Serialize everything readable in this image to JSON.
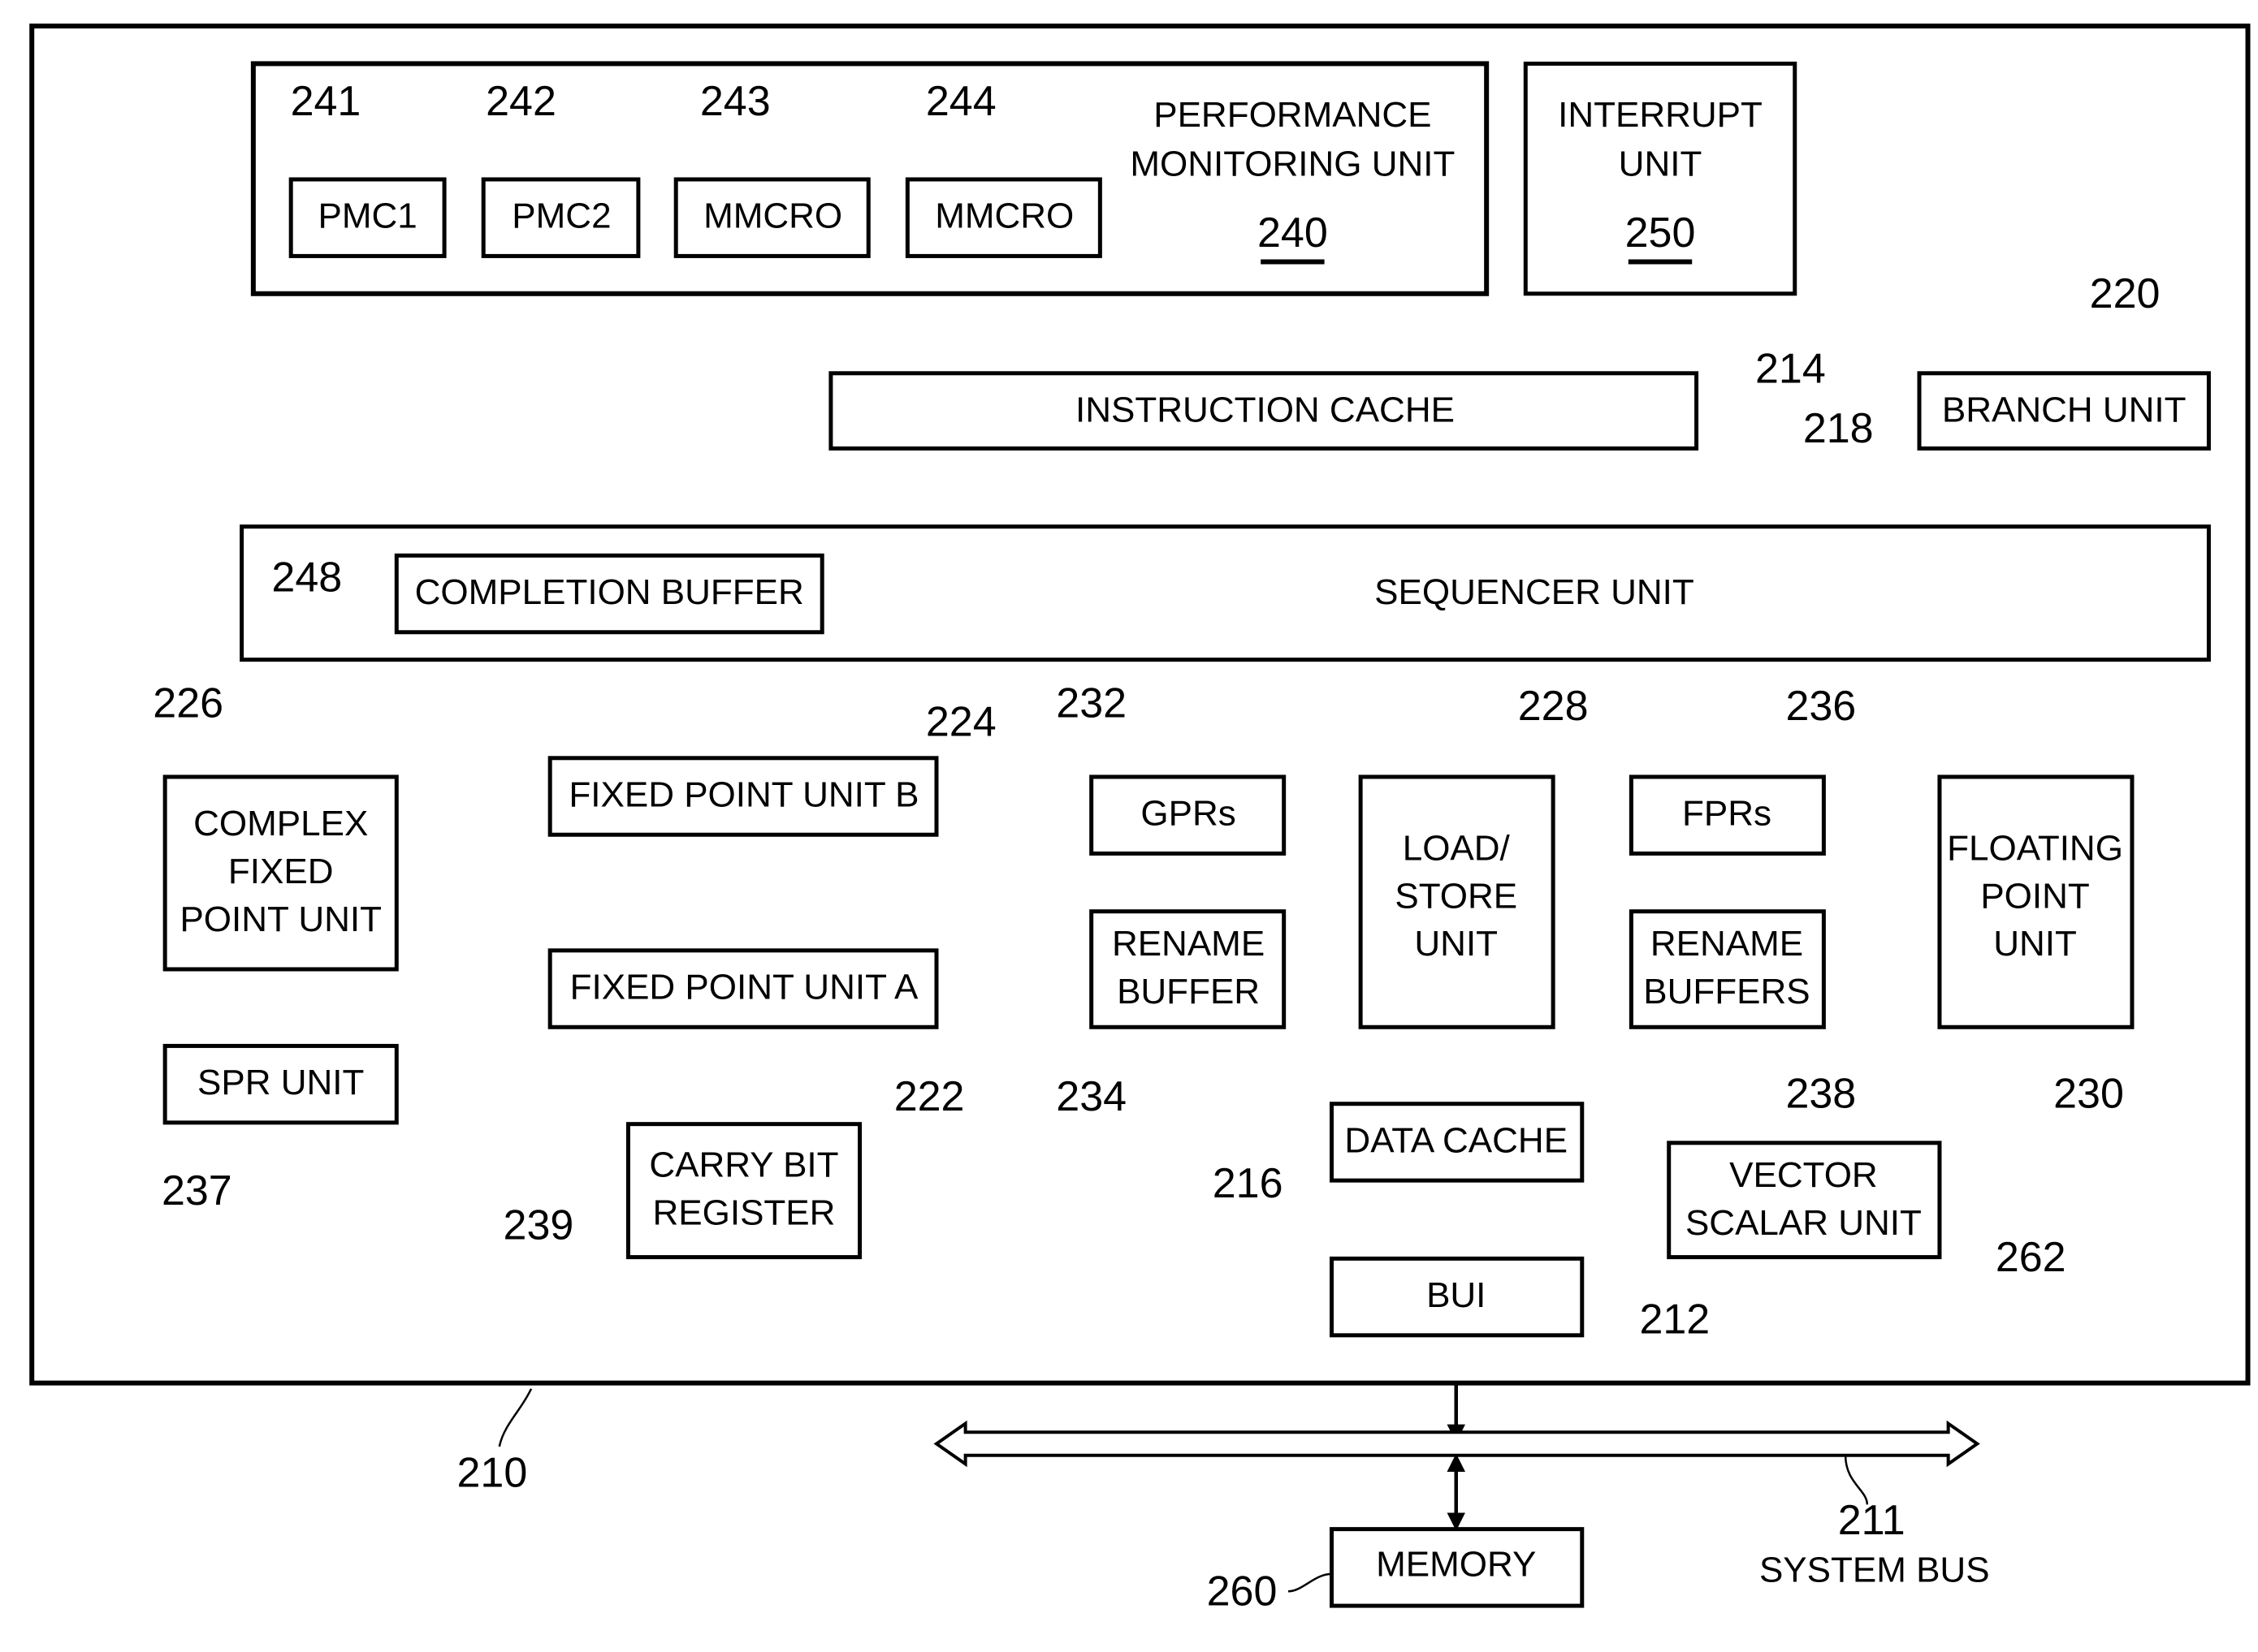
{
  "blocks": {
    "pmu": {
      "title_line1": "PERFORMANCE",
      "title_line2": "MONITORING UNIT",
      "ref": "240"
    },
    "pmc1": {
      "label": "PMC1",
      "ref": "241"
    },
    "pmc2": {
      "label": "PMC2",
      "ref": "242"
    },
    "mmcr_a": {
      "label": "MMCRO",
      "ref": "243"
    },
    "mmcr_b": {
      "label": "MMCRO",
      "ref": "244"
    },
    "interrupt": {
      "title_line1": "INTERRUPT",
      "title_line2": "UNIT",
      "ref": "250"
    },
    "icache": {
      "label": "INSTRUCTION CACHE",
      "ref": "214"
    },
    "branch": {
      "label": "BRANCH UNIT",
      "ref": "220"
    },
    "sequencer": {
      "label": "SEQUENCER UNIT",
      "ref": "218"
    },
    "completion": {
      "label": "COMPLETION BUFFER",
      "ref": "248"
    },
    "cfxu": {
      "line1": "COMPLEX",
      "line2": "FIXED",
      "line3": "POINT UNIT",
      "ref": "226"
    },
    "fxub": {
      "label": "FIXED POINT UNIT B",
      "ref": "224"
    },
    "fxua": {
      "label": "FIXED POINT UNIT A",
      "ref": "222"
    },
    "spr": {
      "label": "SPR UNIT",
      "ref": "237"
    },
    "carry": {
      "line1": "CARRY BIT",
      "line2": "REGISTER",
      "ref": "239"
    },
    "gprs": {
      "label": "GPRs",
      "ref": "232"
    },
    "gren": {
      "line1": "RENAME",
      "line2": "BUFFER",
      "ref": "234"
    },
    "lsu": {
      "line1": "LOAD/",
      "line2": "STORE",
      "line3": "UNIT",
      "ref": "228"
    },
    "fprs": {
      "label": "FPRs",
      "ref": "236"
    },
    "fren": {
      "line1": "RENAME",
      "line2": "BUFFERS",
      "ref": "238"
    },
    "fpu": {
      "line1": "FLOATING",
      "line2": "POINT",
      "line3": "UNIT",
      "ref": "230"
    },
    "dcache": {
      "label": "DATA CACHE",
      "ref": "216"
    },
    "vsu": {
      "line1": "VECTOR",
      "line2": "SCALAR UNIT",
      "ref": "262"
    },
    "bui": {
      "label": "BUI",
      "ref": "212"
    },
    "memory": {
      "label": "MEMORY",
      "ref": "260"
    }
  },
  "processor_ref": "210",
  "system_bus": {
    "ref": "211",
    "label": "SYSTEM BUS"
  }
}
